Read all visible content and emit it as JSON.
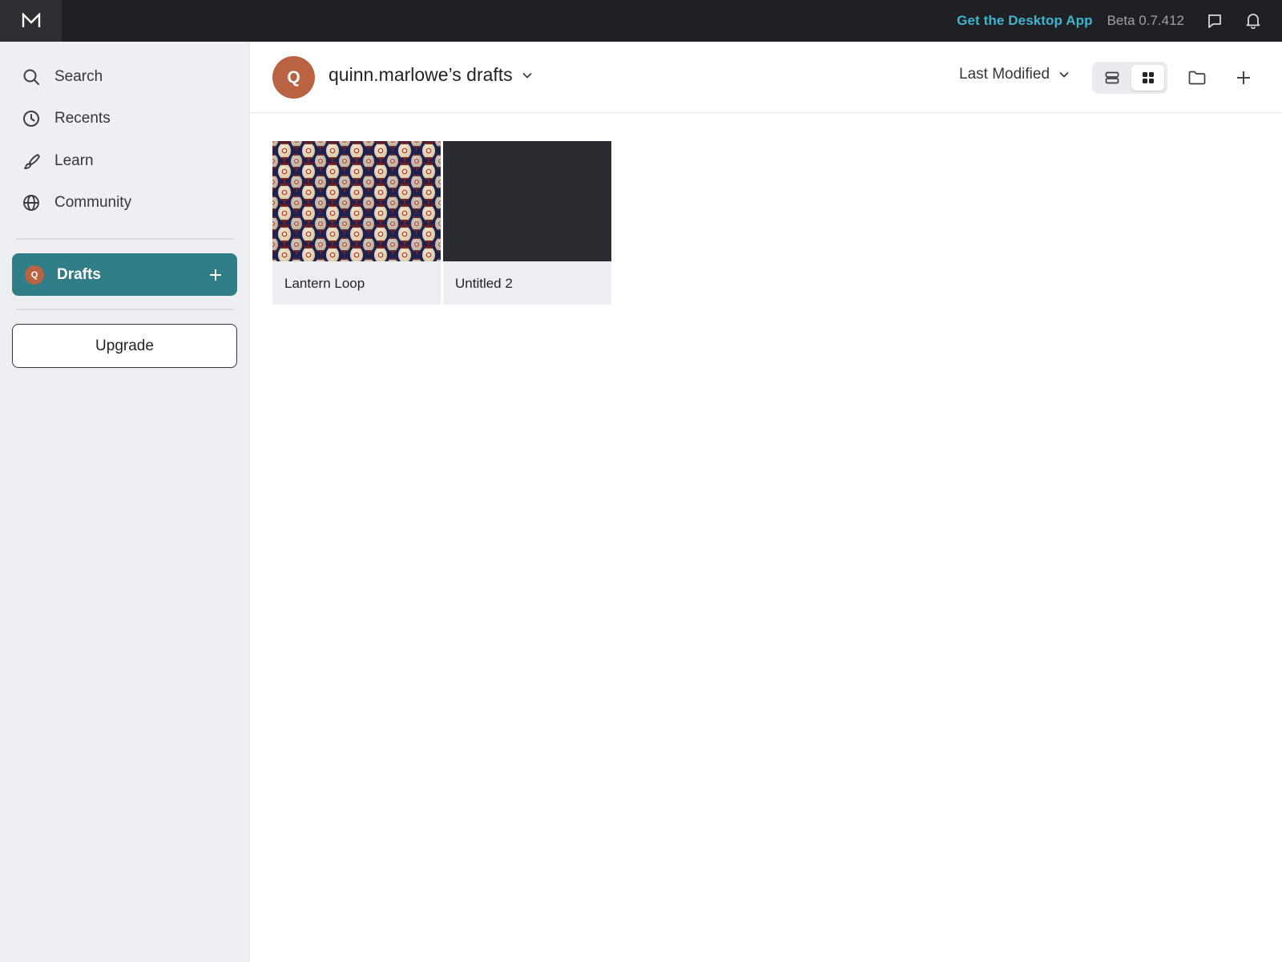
{
  "app": {
    "logo_letter": "M"
  },
  "topbar": {
    "desktop_link": "Get the Desktop App",
    "version": "Beta 0.7.412",
    "accent_color": "#3fb4cf"
  },
  "sidebar": {
    "nav": [
      {
        "label": "Search",
        "icon": "search-icon"
      },
      {
        "label": "Recents",
        "icon": "clock-icon"
      },
      {
        "label": "Learn",
        "icon": "brush-icon"
      },
      {
        "label": "Community",
        "icon": "globe-icon"
      }
    ],
    "drafts": {
      "label": "Drafts",
      "avatar_letter": "Q",
      "color": "#2e7d87"
    },
    "upgrade_label": "Upgrade"
  },
  "header": {
    "avatar_letter": "Q",
    "title": "quinn.marlowe’s drafts",
    "sort_label": "Last Modified",
    "view_mode": "grid"
  },
  "files": [
    {
      "name": "Lantern Loop",
      "thumbnail": "lanterns-photo"
    },
    {
      "name": "Untitled 2",
      "thumbnail": "dark-blank"
    }
  ]
}
